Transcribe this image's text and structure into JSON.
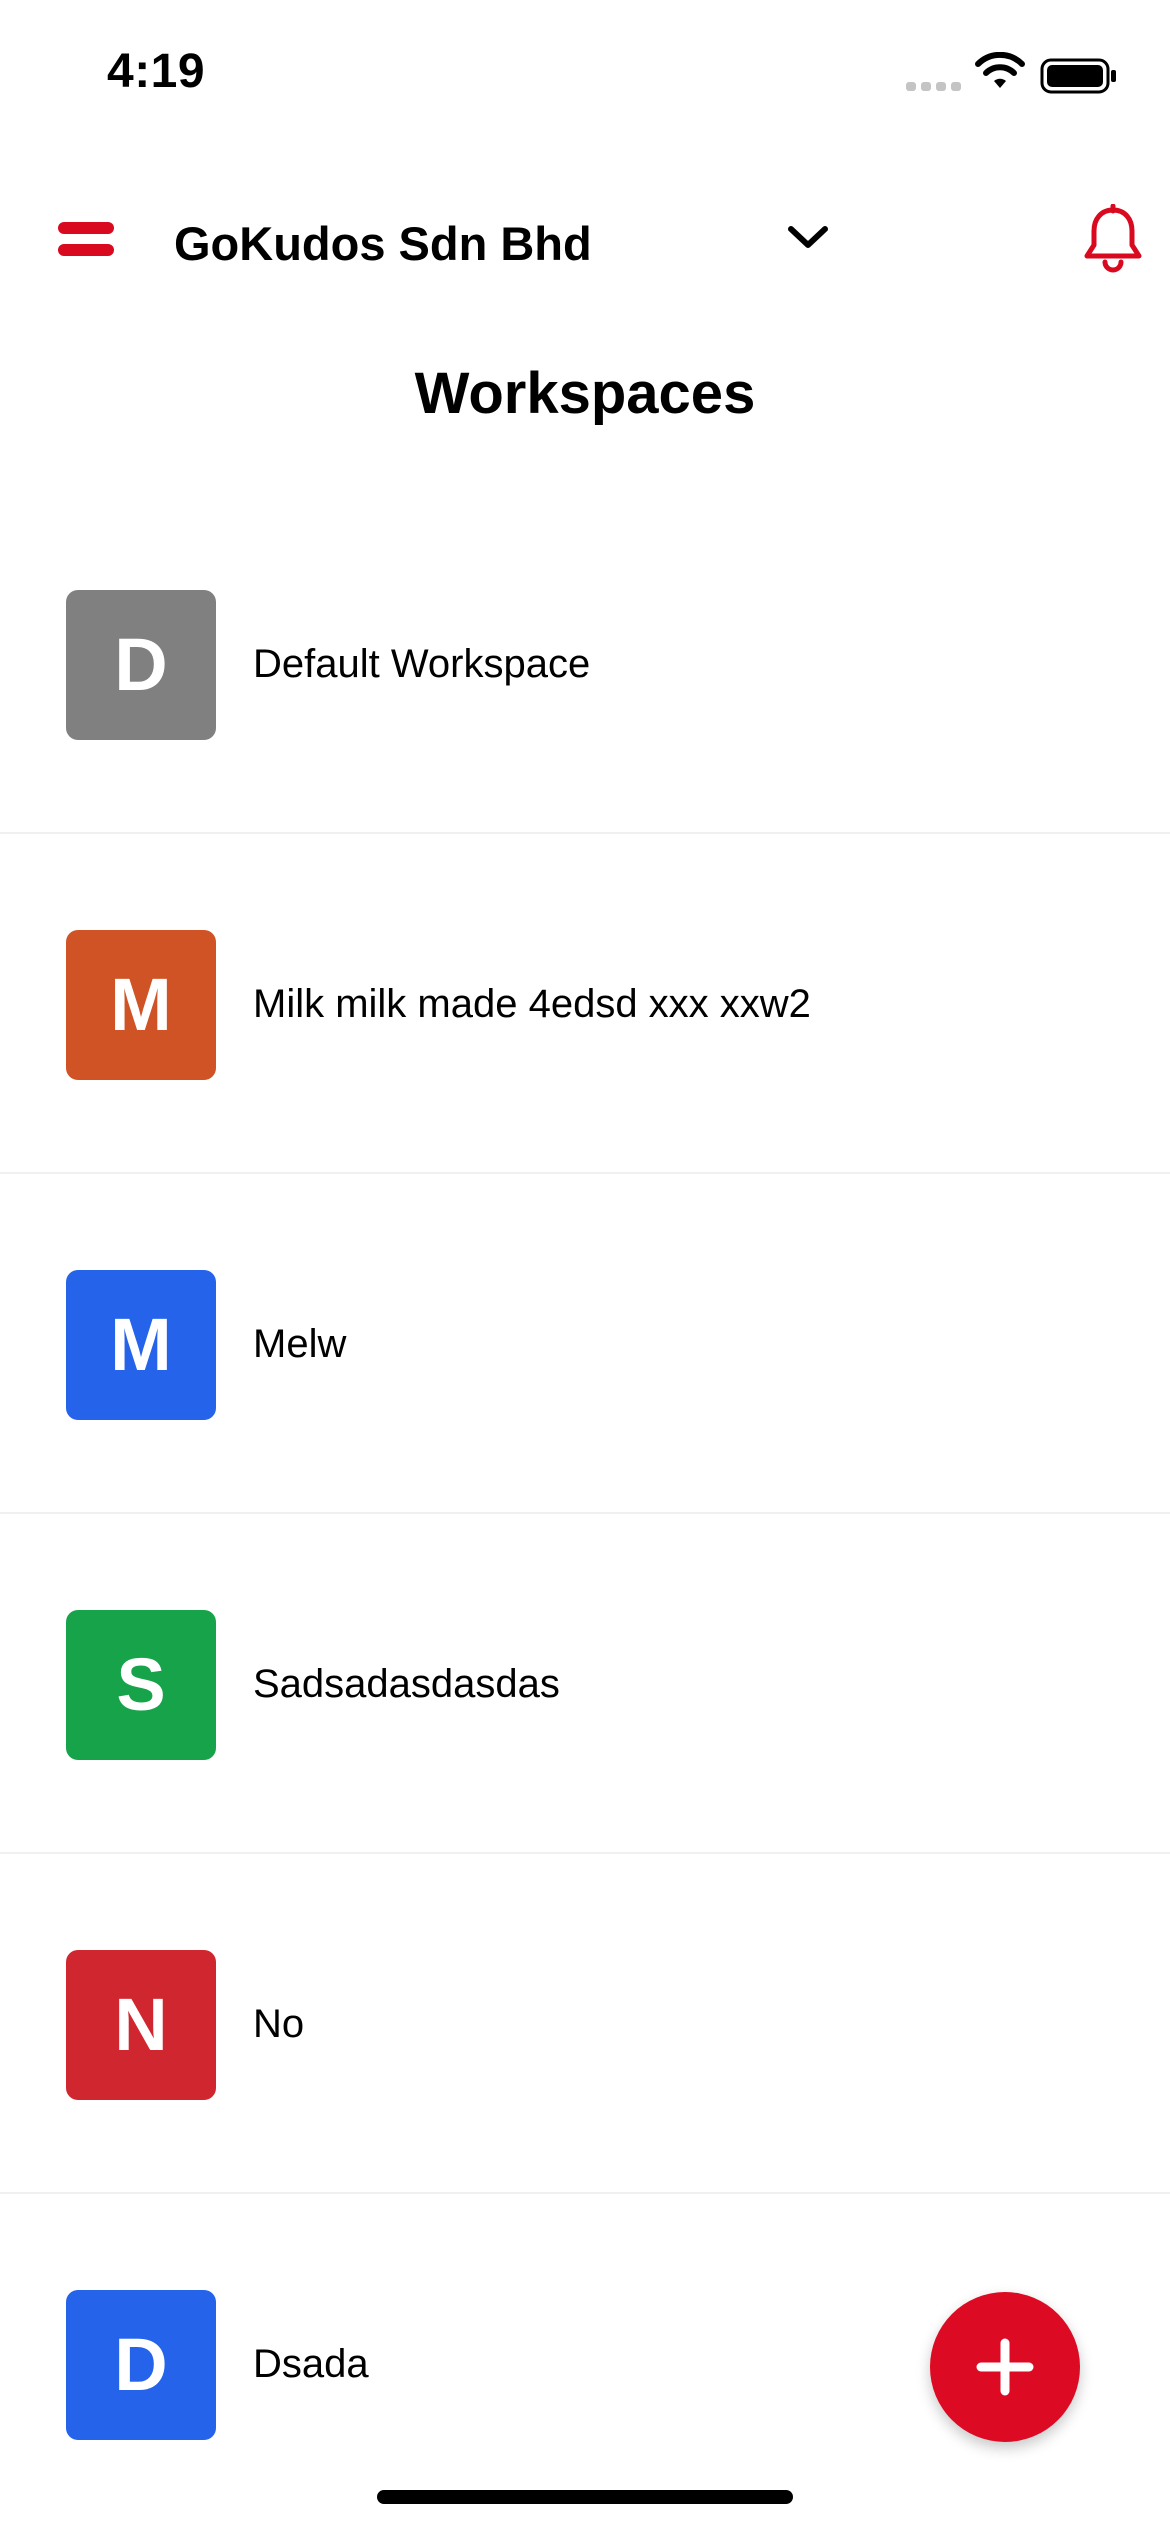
{
  "status_bar": {
    "time": "4:19",
    "icons": [
      "cellular-signal-icon",
      "wifi-icon",
      "battery-icon"
    ]
  },
  "header": {
    "menu_icon": "hamburger-menu-icon",
    "organization": "GoKudos Sdn Bhd",
    "dropdown_icon": "chevron-down-icon",
    "notification_icon": "bell-icon"
  },
  "page": {
    "title": "Workspaces"
  },
  "workspaces": [
    {
      "initial": "D",
      "name": "Default Workspace",
      "color": "#808080"
    },
    {
      "initial": "M",
      "name": "Milk milk made 4edsd xxx xxw2",
      "color": "#cf5325"
    },
    {
      "initial": "M",
      "name": "Melw",
      "color": "#2563eb"
    },
    {
      "initial": "S",
      "name": "Sadsadasdasdas",
      "color": "#16a34a"
    },
    {
      "initial": "N",
      "name": "No",
      "color": "#d0262f"
    },
    {
      "initial": "D",
      "name": "Dsada",
      "color": "#2563eb"
    }
  ],
  "fab": {
    "icon": "plus-icon",
    "color": "#dc0a23"
  },
  "colors": {
    "accent": "#d9091f"
  }
}
